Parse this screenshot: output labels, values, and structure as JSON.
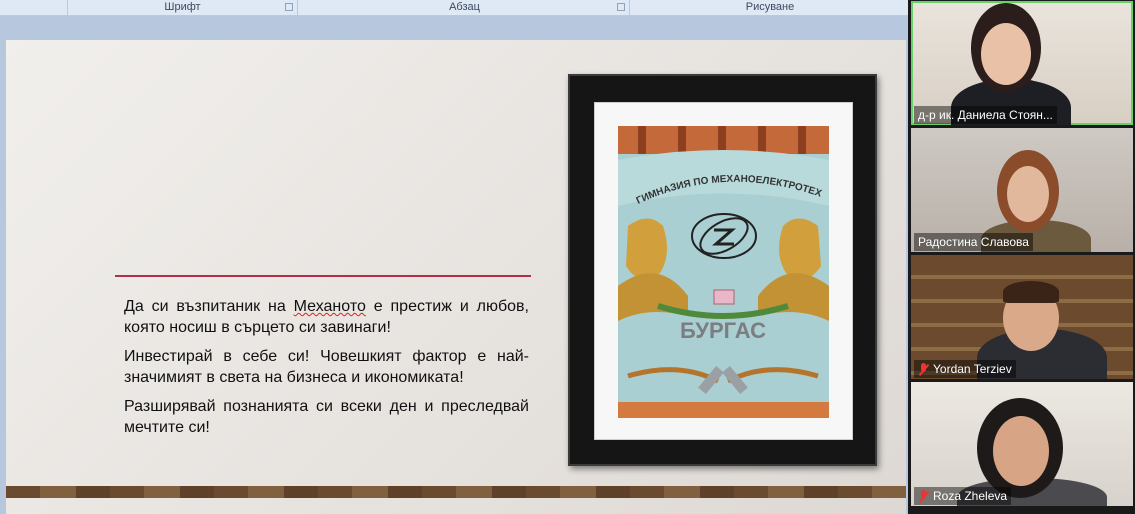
{
  "ribbon": {
    "groups": [
      "Шрифт",
      "Абзац",
      "Рисуване"
    ]
  },
  "slide": {
    "paragraphs": [
      {
        "before": "Да си възпитаник на ",
        "highlight": "Механото",
        "after": " е престиж и любов, която носиш в сърцето си завинаги!"
      },
      {
        "before": "Инвестирай в себе си! Човешкият фактор е най-значимият в света на бизнеса и икономиката!",
        "highlight": "",
        "after": ""
      },
      {
        "before": "Разширявай познанията си всеки ден и преследвай мечтите си!",
        "highlight": "",
        "after": ""
      }
    ],
    "picture": {
      "banner_arc_text": "ГИМНАЗИЯ ПО МЕХАНОЕЛЕКТРОТЕХ",
      "city": "БУРГАС"
    },
    "accent_color": "#b0304a"
  },
  "participants": [
    {
      "name": "д-р ик. Даниела Стоян...",
      "muted": false,
      "active": true
    },
    {
      "name": "Радостина Славова",
      "muted": false,
      "active": false
    },
    {
      "name": "Yordan Terziev",
      "muted": true,
      "active": false
    },
    {
      "name": "Roza Zheleva",
      "muted": true,
      "active": false
    }
  ]
}
